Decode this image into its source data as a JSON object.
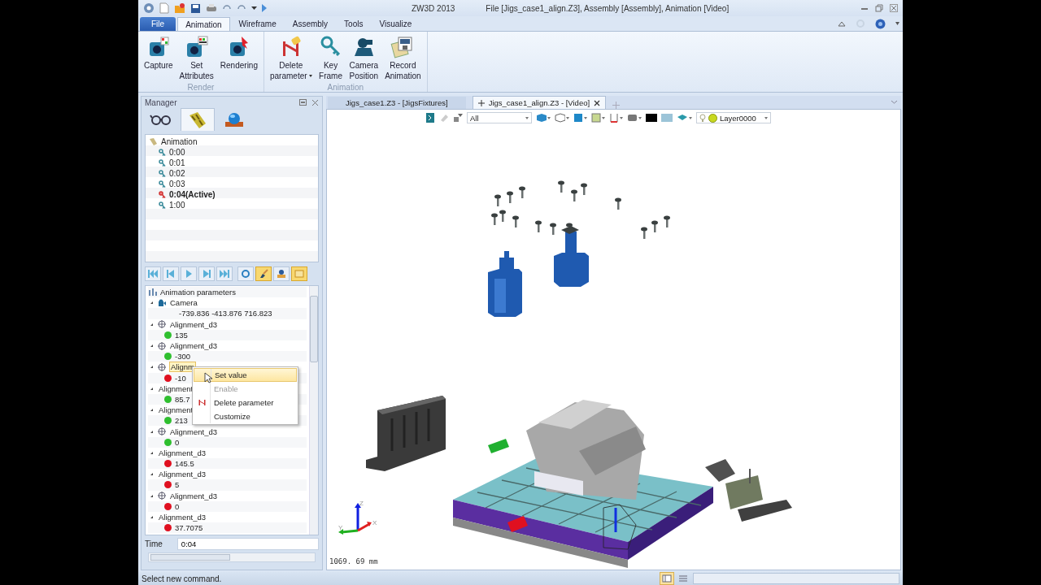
{
  "window": {
    "title": "ZW3D 2013",
    "document": "File [Jigs_case1_align.Z3],  Assembly [Assembly],  Animation [Video]"
  },
  "ribbon_tabs": [
    {
      "label": "File",
      "kind": "file",
      "selected": false
    },
    {
      "label": "Animation",
      "kind": "tab",
      "selected": true
    },
    {
      "label": "Wireframe",
      "kind": "tab",
      "selected": false
    },
    {
      "label": "Assembly",
      "kind": "tab",
      "selected": false
    },
    {
      "label": "Tools",
      "kind": "tab",
      "selected": false
    },
    {
      "label": "Visualize",
      "kind": "tab",
      "selected": false
    }
  ],
  "ribbon_groups": [
    {
      "label": "Render",
      "buttons": [
        {
          "kind": "capture",
          "lines": [
            "Capture"
          ]
        },
        {
          "kind": "attributes",
          "lines": [
            "Set",
            "Attributes"
          ]
        },
        {
          "kind": "rendering",
          "lines": [
            "Rendering"
          ]
        }
      ]
    },
    {
      "label": "Animation",
      "buttons": [
        {
          "kind": "delete",
          "lines": [
            "Delete",
            "parameter"
          ],
          "has_menu": true
        },
        {
          "kind": "key",
          "lines": [
            "Key",
            "Frame"
          ]
        },
        {
          "kind": "camera",
          "lines": [
            "Camera",
            "Position"
          ]
        },
        {
          "kind": "record",
          "lines": [
            "Record",
            "Animation"
          ]
        }
      ]
    }
  ],
  "manager": {
    "title": "Manager",
    "tabs": [
      {
        "kind": "glasses",
        "selected": false
      },
      {
        "kind": "film",
        "selected": true
      },
      {
        "kind": "globe",
        "selected": false
      }
    ],
    "tree": {
      "label": "Animation",
      "children": [
        {
          "label": "0:00",
          "active": false
        },
        {
          "label": "0:01",
          "active": false
        },
        {
          "label": "0:02",
          "active": false
        },
        {
          "label": "0:03",
          "active": false
        },
        {
          "label": "0:04(Active)",
          "active": true
        },
        {
          "label": "1:00",
          "active": false
        }
      ]
    },
    "playback": [
      {
        "kind": "first",
        "on": false
      },
      {
        "kind": "prev",
        "on": false
      },
      {
        "kind": "play",
        "on": false
      },
      {
        "kind": "next",
        "on": false
      },
      {
        "kind": "last",
        "on": false
      },
      {
        "kind": "loop",
        "on": false
      },
      {
        "kind": "brush",
        "on": true
      },
      {
        "kind": "person",
        "on": false
      },
      {
        "kind": "image",
        "on": true
      }
    ],
    "parameters": {
      "title": "Animation parameters",
      "items": [
        {
          "kind": "camera",
          "label": "Camera",
          "value": "-739.836 -413.876 716.823"
        },
        {
          "kind": "crosshair",
          "label": "Alignment_d3",
          "value": "135",
          "color": "#2fbf2f",
          "selected": false
        },
        {
          "kind": "crosshair",
          "label": "Alignment_d3",
          "value": "-300",
          "color": "#2fbf2f",
          "selected": false
        },
        {
          "kind": "crosshair",
          "label": "Alignm",
          "value": "-10",
          "color": "#e01020",
          "selected": true
        },
        {
          "kind": "plain",
          "label": "Alignment",
          "value": "85.7",
          "color": "#2fbf2f",
          "selected": false
        },
        {
          "kind": "plain",
          "label": "Alignment",
          "value": "213",
          "color": "#2fbf2f",
          "selected": false
        },
        {
          "kind": "crosshair",
          "label": "Alignment_d3",
          "value": "0",
          "color": "#2fbf2f",
          "selected": false
        },
        {
          "kind": "plain",
          "label": "Alignment_d3",
          "value": "145.5",
          "color": "#e01020",
          "selected": false
        },
        {
          "kind": "plain",
          "label": "Alignment_d3",
          "value": "5",
          "color": "#e01020",
          "selected": false
        },
        {
          "kind": "crosshair",
          "label": "Alignment_d3",
          "value": "0",
          "color": "#e01020",
          "selected": false
        },
        {
          "kind": "plain",
          "label": "Alignment_d3",
          "value": "37.7075",
          "color": "#e01020",
          "selected": false
        }
      ]
    },
    "context_menu": [
      {
        "label": "Set value",
        "selected": true,
        "disabled": false
      },
      {
        "label": "Enable",
        "selected": false,
        "disabled": true
      },
      {
        "label": "Delete parameter",
        "selected": false,
        "disabled": false,
        "icon": true
      },
      {
        "label": "Customize",
        "selected": false,
        "disabled": false
      }
    ],
    "time": {
      "label": "Time",
      "value": "0:04"
    }
  },
  "document_tabs": [
    {
      "label": "Jigs_case1.Z3 - [JigsFixtures]",
      "selected": false
    },
    {
      "label": "Jigs_case1_align.Z3 - [Video]",
      "selected": true
    }
  ],
  "view_toolbar": {
    "filter": "All",
    "layer": "Layer0000"
  },
  "viewport": {
    "axes": [
      "Z",
      "Y",
      "X"
    ],
    "scale": "1069. 69 mm"
  },
  "status_bar": "Select new command."
}
